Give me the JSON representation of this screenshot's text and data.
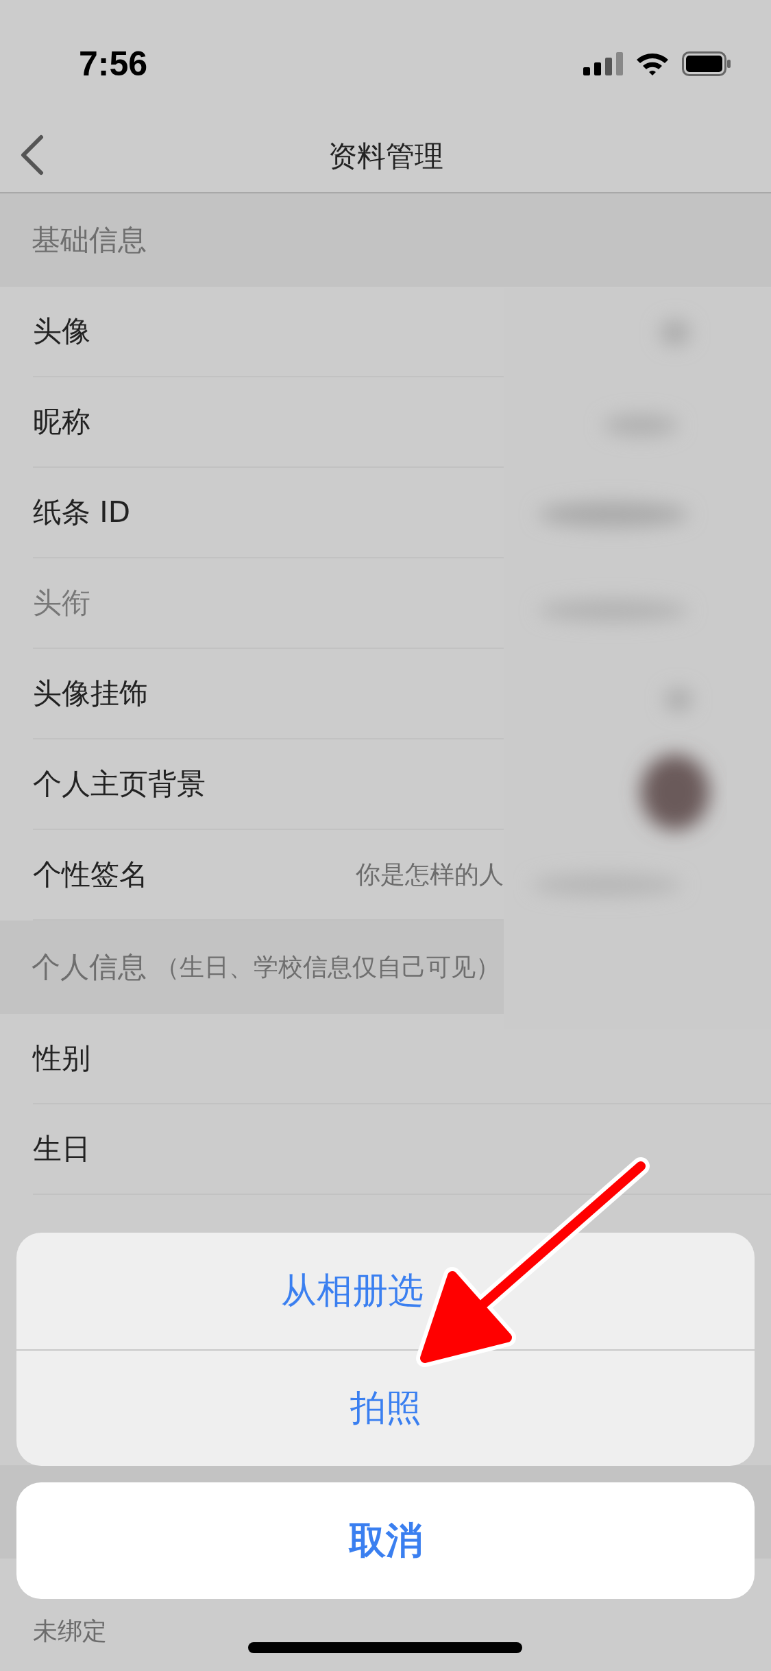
{
  "status_bar": {
    "time": "7:56"
  },
  "nav": {
    "title": "资料管理"
  },
  "sections": [
    {
      "title": "基础信息",
      "rows": [
        {
          "label": "头像",
          "disabled": false,
          "value": null
        },
        {
          "label": "昵称",
          "disabled": false,
          "value": null
        },
        {
          "label": "纸条 ID",
          "disabled": false,
          "value": null
        },
        {
          "label": "头衔",
          "disabled": true,
          "value": null
        },
        {
          "label": "头像挂饰",
          "disabled": false,
          "value": null
        },
        {
          "label": "个人主页背景",
          "disabled": false,
          "value": null
        },
        {
          "label": "个性签名",
          "disabled": false,
          "value": "你是怎样的人"
        }
      ]
    },
    {
      "title": "个人信息",
      "note": "（生日、学校信息仅自己可见）",
      "rows": [
        {
          "label": "性别",
          "disabled": false,
          "value": null
        },
        {
          "label": "生日",
          "disabled": false,
          "value": null
        }
      ]
    }
  ],
  "account_row": {
    "value": "未绑定"
  },
  "action_sheet": {
    "options": [
      "从相册选",
      "拍照"
    ],
    "cancel": "取消"
  }
}
